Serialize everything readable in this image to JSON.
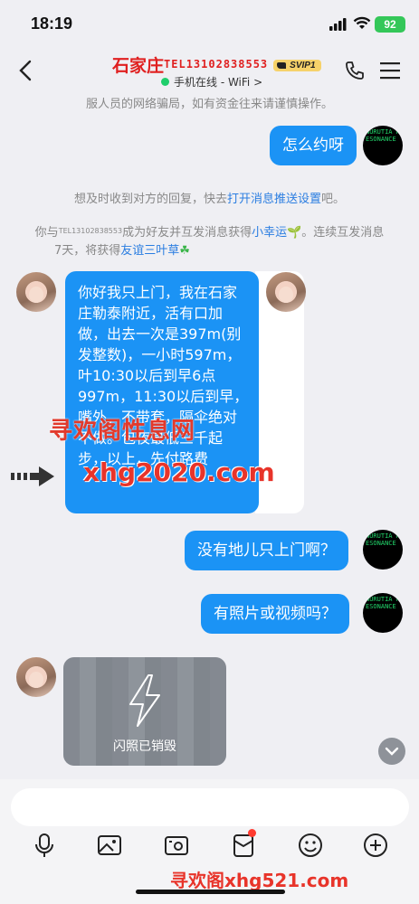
{
  "status_bar": {
    "time": "18:19",
    "battery": "92"
  },
  "header": {
    "title": "石家庄",
    "title_tel": "TEL13102838553",
    "vip_badge": "SVIP1",
    "online_status": "手机在线 - WiFi >"
  },
  "chat": {
    "top_notice": "服人员的网络骗局，如有资金往来请谨慎操作。",
    "my_msg_1": "怎么约呀",
    "push_notice_prefix": "想及时收到对方的回复，快去",
    "push_notice_link": "打开消息推送设置",
    "push_notice_suffix": "吧。",
    "friend_notice_line1_a": "你与",
    "friend_notice_tel": "TEL13102838553",
    "friend_notice_line1_b": "成为好友并互发消息获得",
    "friend_notice_link1": "小幸运",
    "friend_notice_line1_c": "。连续互发消息",
    "friend_notice_line2_a": "7天，将获得",
    "friend_notice_link2": "友谊三叶草",
    "their_long_msg": "你好我只上门，我在石家庄勒泰附近，活有口加做，出去一次是397m(别发整数)，一小时597m，叶10:30以后到早6点997m，11:30以后到早，嘴外，不带套，隔伞绝对不做。包夜最低三千起步，以上，先付路费",
    "my_msg_2": "没有地儿只上门啊？",
    "my_msg_3": "有照片或视频吗？",
    "flash_photo_label": "闪照已销毁",
    "avatar_text": "NURUTIA RESONANCE"
  },
  "watermarks": {
    "wm1": "寻欢阁性息网",
    "wm2": "xhg2020.com",
    "wm3": "寻欢阁xhg521.com"
  },
  "input": {
    "placeholder": ""
  },
  "colors": {
    "bubble_blue": "#1b93f5",
    "title_red": "#e02020",
    "link_blue": "#2a7de1"
  }
}
